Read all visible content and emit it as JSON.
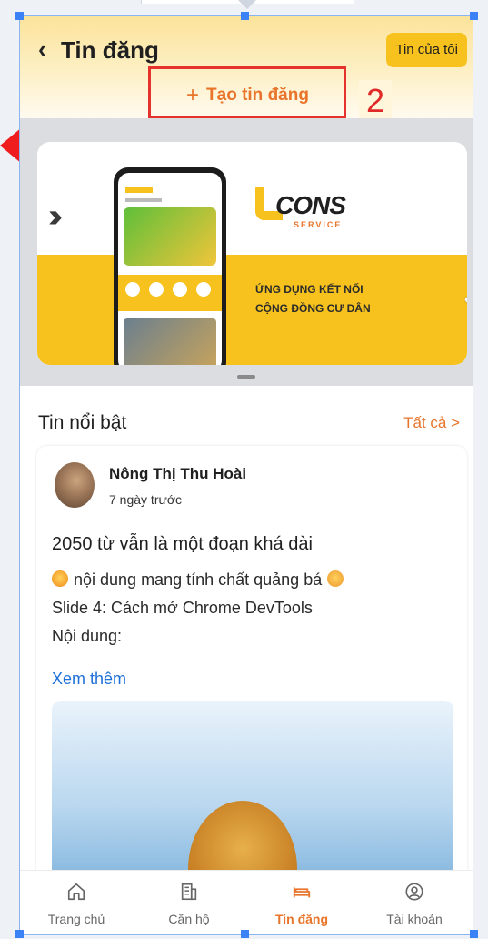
{
  "header": {
    "back_icon": "chevron-left-icon",
    "title": "Tin đăng",
    "my_posts_label": "Tin của tôi",
    "create_label": "Tạo tin đăng",
    "step_number": "2"
  },
  "banner": {
    "logo_text": "CONS",
    "logo_sub": "SERVICE",
    "caption_line1": "ỨNG DỤNG KẾT NỐI",
    "caption_line2": "CỘNG ĐỒNG CƯ DÂN"
  },
  "featured": {
    "title": "Tin nổi bật",
    "see_all_label": "Tất cả >"
  },
  "post": {
    "author": "Nông Thị Thu Hoài",
    "time": "7 ngày trước",
    "title": "2050 từ vẫn là một đoạn khá dài",
    "body_line1": "nội dung mang tính chất quảng bá",
    "body_line2": "Slide 4: Cách mở Chrome DevTools",
    "body_line3": "Nội dung:",
    "see_more": "Xem thêm"
  },
  "tabbar": {
    "items": [
      {
        "label": "Trang chủ",
        "icon": "home-icon"
      },
      {
        "label": "Căn hộ",
        "icon": "building-icon"
      },
      {
        "label": "Tin đăng",
        "icon": "bed-icon"
      },
      {
        "label": "Tài khoản",
        "icon": "user-icon"
      }
    ],
    "active_index": 2
  },
  "colors": {
    "accent": "#f7c21d",
    "accent_orange": "#e8752b",
    "annotation_red": "#e6322d",
    "link_blue": "#1f70d8"
  }
}
